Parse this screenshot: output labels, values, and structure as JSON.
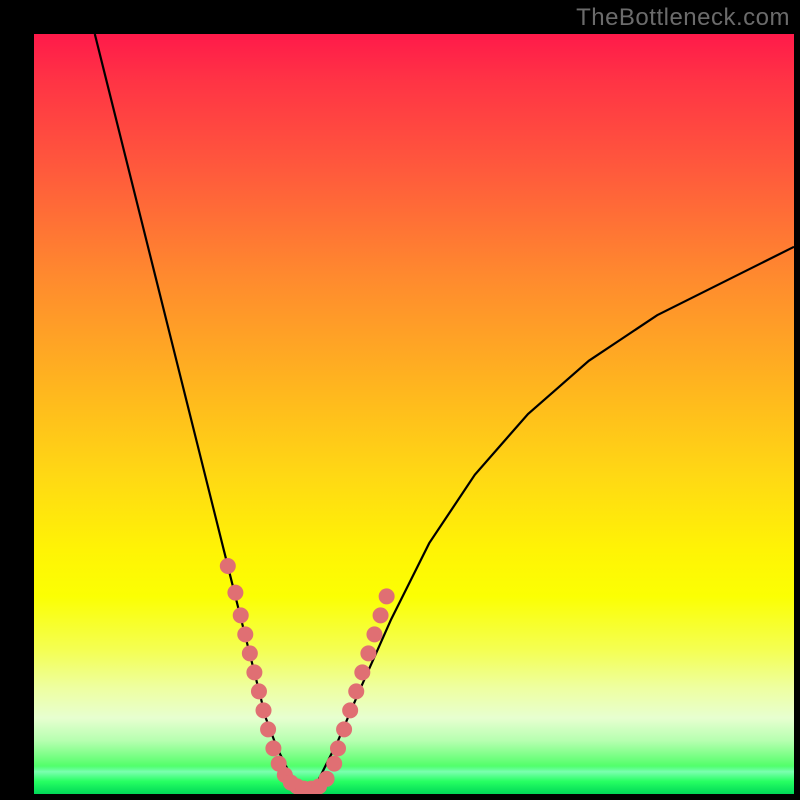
{
  "watermark": "TheBottleneck.com",
  "colors": {
    "frame_bg": "#000000",
    "curve_stroke": "#000000",
    "marker_fill": "#e06f73",
    "gradient_top": "#ff1a4a",
    "gradient_mid": "#fff405",
    "gradient_bottom": "#00e060"
  },
  "chart_data": {
    "type": "line",
    "title": "",
    "xlabel": "",
    "ylabel": "",
    "xlim": [
      0,
      100
    ],
    "ylim": [
      0,
      100
    ],
    "grid": false,
    "legend": false,
    "series": [
      {
        "name": "bottleneck-curve",
        "x": [
          8,
          12,
          16,
          20,
          23,
          25,
          27,
          29,
          30.5,
          32,
          33.5,
          35,
          36,
          37,
          38,
          40,
          43,
          47,
          52,
          58,
          65,
          73,
          82,
          92,
          100
        ],
        "y": [
          100,
          84,
          68,
          52,
          40,
          32,
          24,
          16,
          10,
          6,
          3,
          1,
          0.5,
          1,
          3,
          7,
          14,
          23,
          33,
          42,
          50,
          57,
          63,
          68,
          72
        ]
      }
    ],
    "markers": [
      {
        "name": "highlight-dots",
        "x": [
          25.5,
          26.5,
          27.2,
          27.8,
          28.4,
          29.0,
          29.6,
          30.2,
          30.8,
          31.5,
          32.2,
          33.0,
          33.8,
          34.6,
          35.5,
          36.5,
          37.5,
          38.5,
          39.5,
          40.0,
          40.8,
          41.6,
          42.4,
          43.2,
          44.0,
          44.8,
          45.6,
          46.4
        ],
        "y": [
          30,
          26.5,
          23.5,
          21,
          18.5,
          16,
          13.5,
          11,
          8.5,
          6,
          4,
          2.5,
          1.5,
          1,
          0.7,
          0.7,
          1,
          2,
          4,
          6,
          8.5,
          11,
          13.5,
          16,
          18.5,
          21,
          23.5,
          26
        ]
      }
    ],
    "annotations": [],
    "note": "Axes are unlabeled in the source image; x/y values are estimated on a 0–100 normalized scale from pixel positions."
  }
}
